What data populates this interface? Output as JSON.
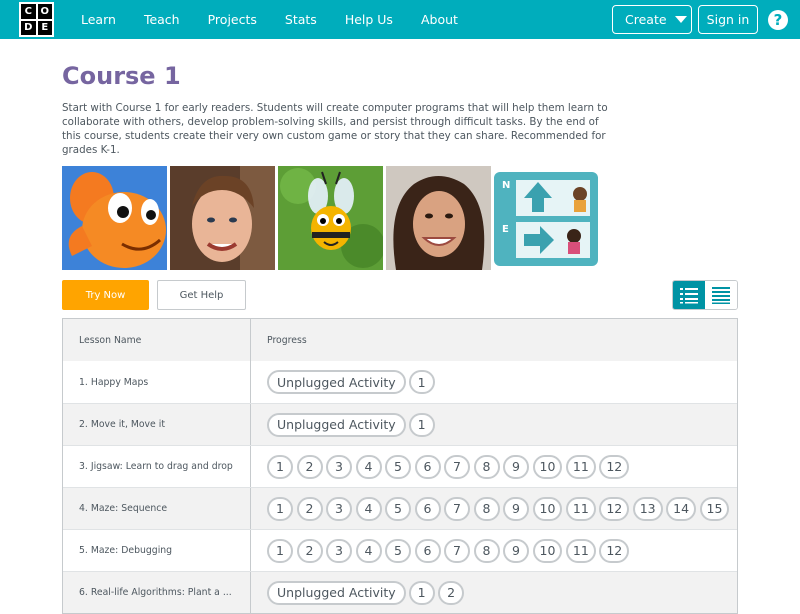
{
  "header": {
    "logo_letters": [
      "C",
      "O",
      "D",
      "E"
    ],
    "nav": [
      "Learn",
      "Teach",
      "Projects",
      "Stats",
      "Help Us",
      "About"
    ],
    "create_label": "Create",
    "signin_label": "Sign in",
    "help_glyph": "?",
    "color": "#00adbc"
  },
  "course": {
    "title": "Course 1",
    "description": "Start with Course 1 for early readers. Students will create computer programs that will help them learn to collaborate with others, develop problem-solving skills, and persist through difficult tasks. By the end of this course, students create their very own custom game or story that they can share. Recommended for grades K-1.",
    "title_color": "#7665a0"
  },
  "thumbnails": [
    "orange-fish",
    "man-portrait",
    "bee-character",
    "woman-portrait",
    "arrow-blocks"
  ],
  "actions": {
    "try_now": "Try Now",
    "get_help": "Get Help",
    "try_color": "#ffa400"
  },
  "view_toggle": {
    "active": "detail-list-icon",
    "inactive": "summary-list-icon"
  },
  "table": {
    "headers": [
      "Lesson Name",
      "Progress"
    ],
    "rows": [
      {
        "name": "1. Happy Maps",
        "progress": [
          "Unplugged Activity",
          "1"
        ]
      },
      {
        "name": "2. Move it, Move it",
        "progress": [
          "Unplugged Activity",
          "1"
        ]
      },
      {
        "name": "3. Jigsaw: Learn to drag and drop",
        "progress": [
          "1",
          "2",
          "3",
          "4",
          "5",
          "6",
          "7",
          "8",
          "9",
          "10",
          "11",
          "12"
        ]
      },
      {
        "name": "4. Maze: Sequence",
        "progress": [
          "1",
          "2",
          "3",
          "4",
          "5",
          "6",
          "7",
          "8",
          "9",
          "10",
          "11",
          "12",
          "13",
          "14",
          "15"
        ]
      },
      {
        "name": "5. Maze: Debugging",
        "progress": [
          "1",
          "2",
          "3",
          "4",
          "5",
          "6",
          "7",
          "8",
          "9",
          "10",
          "11",
          "12"
        ]
      },
      {
        "name": "6. Real-life Algorithms: Plant a ...",
        "progress": [
          "Unplugged Activity",
          "1",
          "2"
        ]
      }
    ]
  }
}
